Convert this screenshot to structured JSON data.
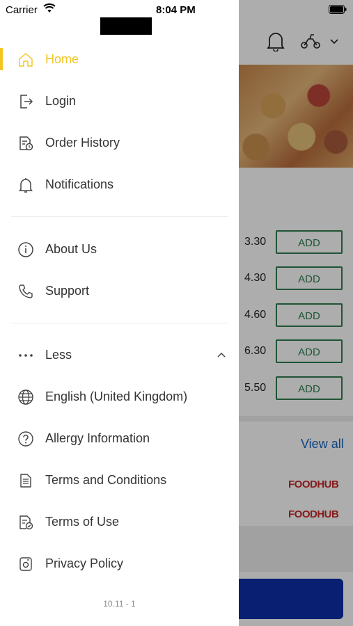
{
  "status_bar": {
    "carrier": "Carrier",
    "time": "8:04 PM"
  },
  "menu": {
    "primary": [
      {
        "label": "Home",
        "icon": "home-icon",
        "active": true
      },
      {
        "label": "Login",
        "icon": "login-icon"
      },
      {
        "label": "Order History",
        "icon": "order-history-icon"
      },
      {
        "label": "Notifications",
        "icon": "bell-icon"
      }
    ],
    "secondary": [
      {
        "label": "About Us",
        "icon": "info-icon"
      },
      {
        "label": "Support",
        "icon": "phone-icon"
      }
    ],
    "less_label": "Less",
    "more": [
      {
        "label": "English (United Kingdom)",
        "icon": "globe-icon"
      },
      {
        "label": "Allergy Information",
        "icon": "question-icon"
      },
      {
        "label": "Terms and Conditions",
        "icon": "document-icon"
      },
      {
        "label": "Terms of Use",
        "icon": "document-check-icon"
      },
      {
        "label": "Privacy Policy",
        "icon": "privacy-icon"
      }
    ],
    "version": "10.11 - 1"
  },
  "background": {
    "items": [
      {
        "price": "3.30",
        "button": "ADD"
      },
      {
        "price": "4.30",
        "button": "ADD"
      },
      {
        "price": "4.60",
        "button": "ADD"
      },
      {
        "price": "6.30",
        "button": "ADD"
      },
      {
        "price": "5.50",
        "button": "ADD"
      }
    ],
    "view_all": "View all",
    "brands": [
      "FOODHUB",
      "FOODHUB"
    ]
  },
  "colors": {
    "accent": "#f3c623",
    "add_green": "#2e7d4f",
    "link_blue": "#1565c0",
    "cta_blue": "#0d2fa8",
    "brand_red": "#c62828"
  }
}
